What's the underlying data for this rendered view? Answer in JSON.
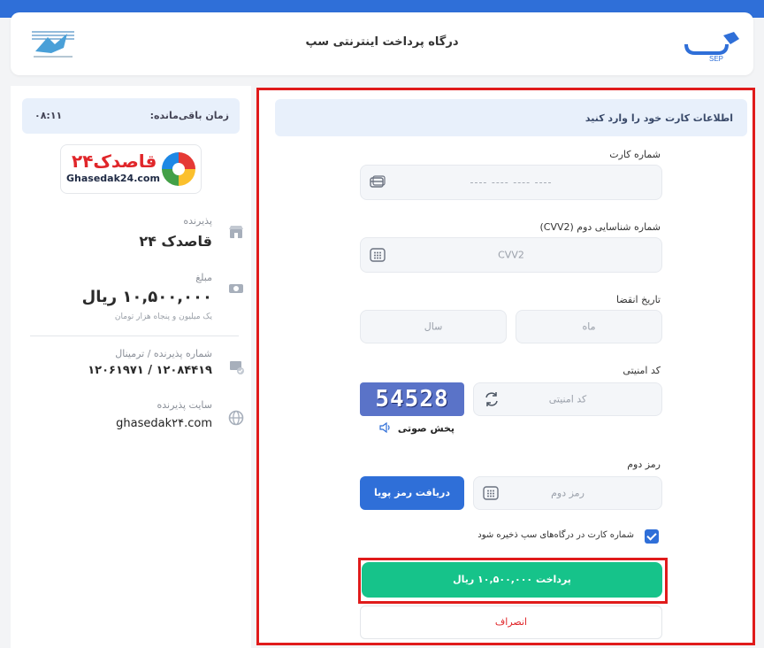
{
  "header": {
    "title": "درگاه پرداخت اینترنتی سپ",
    "sep_logo_text": "SEP",
    "bank_logo_icon": "bank-emblem-icon"
  },
  "side": {
    "timer_label": "زمان باقی‌مانده:",
    "timer_value": "۰۸:۱۱",
    "merchant_logo_text": "قاصدک۲۴",
    "merchant_logo_sub": "Ghasedak24.com",
    "acceptor_label": "پذیرنده",
    "acceptor_value": "قاصدک ۲۴",
    "amount_label": "مبلغ",
    "amount_value": "۱۰,۵۰۰,۰۰۰ ریال",
    "amount_words": "یک میلیون و پنجاه هزار تومان",
    "terminal_label": "شماره پذیرنده / ترمینال",
    "terminal_value": "۱۲۰۸۴۴۱۹ / ۱۲۰۶۱۹۷۱",
    "site_label": "سایت پذیرنده",
    "site_value": "ghasedak۲۴.com"
  },
  "form": {
    "heading": "اطلاعات کارت خود را وارد کنید",
    "card_label": "شماره کارت",
    "card_placeholder": "---- ---- ---- ----",
    "cvv_label": "شماره شناسایی دوم (CVV2)",
    "cvv_placeholder": "CVV2",
    "expiry_label": "تاریخ انقضا",
    "month_placeholder": "ماه",
    "year_placeholder": "سال",
    "captcha_label": "کد امنیتی",
    "captcha_placeholder": "کد امنیتی",
    "captcha_image_text": "54528",
    "audio_label": "پخش صوتی",
    "otp_label": "رمز دوم",
    "otp_placeholder": "رمز دوم",
    "otp_button": "دریافت رمز پویا",
    "save_card_label": "شماره کارت در درگاه‌های سپ ذخیره شود",
    "pay_button": "پرداخت ۱۰,۵۰۰,۰۰۰ ریال",
    "cancel_button": "انصراف"
  },
  "colors": {
    "accent": "#2f6fd8",
    "pay": "#16c38a",
    "highlight": "#e01b1b"
  }
}
